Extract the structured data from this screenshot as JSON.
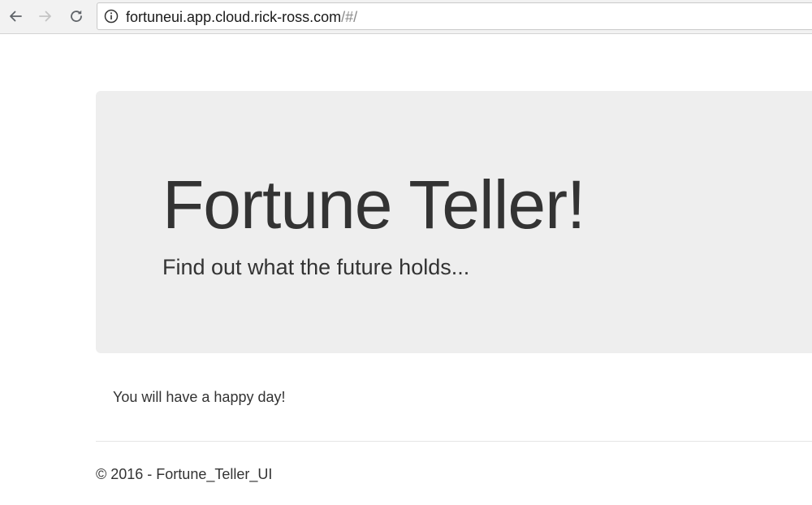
{
  "browser": {
    "url_host": "fortuneui.app.cloud.rick-ross.com",
    "url_path": "/#/",
    "icons": {
      "back": "arrow-left-icon",
      "forward": "arrow-right-icon",
      "reload": "reload-icon",
      "site_info": "info-icon"
    }
  },
  "jumbotron": {
    "title": "Fortune Teller!",
    "subtitle": "Find out what the future holds..."
  },
  "fortune": {
    "text": "You will have a happy day!"
  },
  "footer": {
    "text": "© 2016 - Fortune_Teller_UI"
  },
  "colors": {
    "text": "#333333",
    "jumbotron_bg": "#eeeeee",
    "chrome_bg": "#f2f2f2"
  }
}
